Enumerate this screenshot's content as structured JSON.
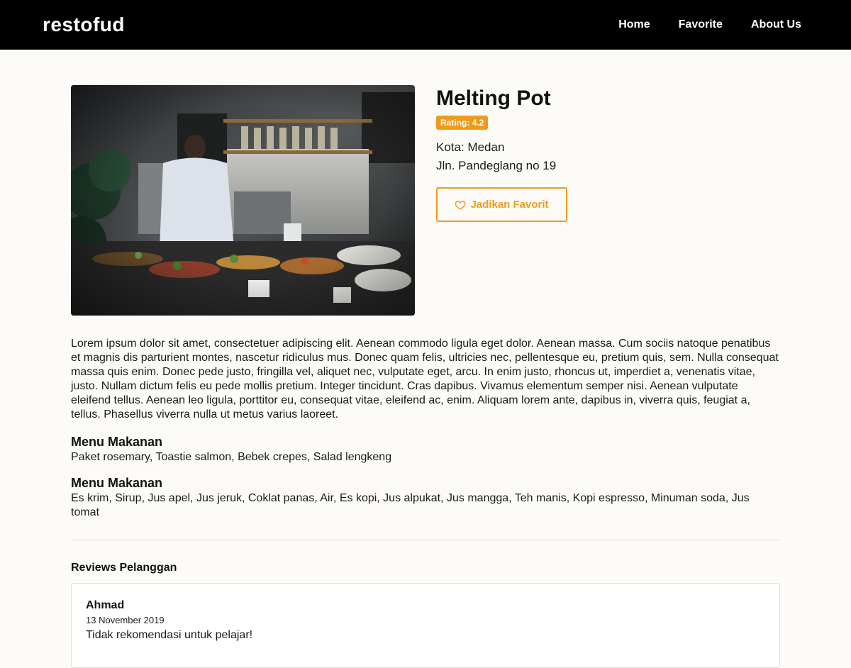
{
  "header": {
    "brand": "restofud",
    "nav": [
      {
        "label": "Home"
      },
      {
        "label": "Favorite"
      },
      {
        "label": "About Us"
      }
    ]
  },
  "restaurant": {
    "name": "Melting Pot",
    "rating_label": "Rating: 4.2",
    "city_line": "Kota: Medan",
    "address": "Jln. Pandeglang no 19",
    "favorite_button": "Jadikan Favorit",
    "description": "Lorem ipsum dolor sit amet, consectetuer adipiscing elit. Aenean commodo ligula eget dolor. Aenean massa. Cum sociis natoque penatibus et magnis dis parturient montes, nascetur ridiculus mus. Donec quam felis, ultricies nec, pellentesque eu, pretium quis, sem. Nulla consequat massa quis enim. Donec pede justo, fringilla vel, aliquet nec, vulputate eget, arcu. In enim justo, rhoncus ut, imperdiet a, venenatis vitae, justo. Nullam dictum felis eu pede mollis pretium. Integer tincidunt. Cras dapibus. Vivamus elementum semper nisi. Aenean vulputate eleifend tellus. Aenean leo ligula, porttitor eu, consequat vitae, eleifend ac, enim. Aliquam lorem ante, dapibus in, viverra quis, feugiat a, tellus. Phasellus viverra nulla ut metus varius laoreet."
  },
  "menus": [
    {
      "title": "Menu Makanan",
      "items": "Paket rosemary, Toastie salmon, Bebek crepes, Salad lengkeng"
    },
    {
      "title": "Menu Makanan",
      "items": "Es krim, Sirup, Jus apel, Jus jeruk, Coklat panas, Air, Es kopi, Jus alpukat, Jus mangga, Teh manis, Kopi espresso, Minuman soda, Jus tomat"
    }
  ],
  "reviews": {
    "title": "Reviews Pelanggan",
    "items": [
      {
        "name": "Ahmad",
        "date": "13 November 2019",
        "text": "Tidak rekomendasi untuk pelajar!"
      }
    ]
  },
  "colors": {
    "accent": "#f19a1a",
    "navbar": "#000000",
    "background": "#fcfbf8"
  },
  "icons": {
    "favorite": "heart-outline-icon",
    "image": "restaurant-kitchen-photo"
  }
}
